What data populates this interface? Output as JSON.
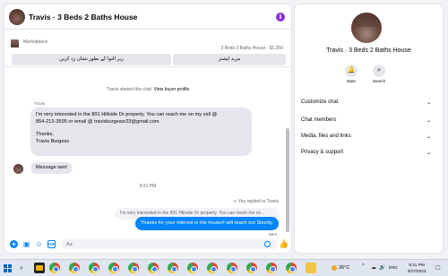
{
  "chat": {
    "title": "Travis · 3 Beds 2 Baths House",
    "info_icon": "i",
    "listing": {
      "label": "Marketplace",
      "title": "3 Beds 2 Baths House · $1,350",
      "pending_button": "زیر التوا کے بطور نشان زد کریں",
      "more_button": "مزید اپشنز"
    },
    "system_note_pre": "Travis started this chat.",
    "system_note_link": "View buyer profile",
    "messages": {
      "sender": "Travis",
      "bubble1_line1": "I'm very interested in the 801 Hillside Dr property. You can reach me on my cell @",
      "bubble1_line2": "854-213-3595 or email @ travisburgessr23@gmail.com",
      "bubble1_line3": "Thanks,",
      "bubble1_line4": "Travis Burgess",
      "bubble2": "Message sent",
      "timestamp": "9:31 PM",
      "replied_to": "You replied to Travis",
      "quote": "I'm very interested in the 801 Hillside Dr property. You can reach me on...",
      "reply": "Thanks for your interest in the house!I will reach out Shortly.",
      "sent": "Sent"
    },
    "composer": {
      "placeholder": "Aa",
      "plus_icon": "+",
      "image_icon": "▣",
      "sticker_icon": "☺",
      "gif_icon": "GIF",
      "like_icon": "👍"
    }
  },
  "info": {
    "name": "Travis · 3 Beds 2 Baths House",
    "actions": [
      {
        "label": "Mute",
        "icon": "🔔"
      },
      {
        "label": "Search",
        "icon": "⌕"
      }
    ],
    "sections": [
      {
        "label": "Customize chat",
        "chevron": "⌄"
      },
      {
        "label": "Chat members",
        "chevron": "⌄"
      },
      {
        "label": "Media, files and links",
        "chevron": "⌄"
      },
      {
        "label": "Privacy & support",
        "chevron": "⌄"
      }
    ]
  },
  "taskbar": {
    "search_icon": "⌕",
    "weather": "26°C",
    "tray_chevron": "^",
    "tray_icon1": "☁",
    "tray_icon2": "🔊",
    "lang": "ENG",
    "net": "",
    "time": "9:31 PM",
    "date": "3/27/2023",
    "notif": "▢"
  },
  "colors": {
    "accent": "#0084ff",
    "bubble_gray": "#e4e6eb",
    "info_purple": "#8a2be2",
    "page_bg": "#f0f2f5"
  }
}
